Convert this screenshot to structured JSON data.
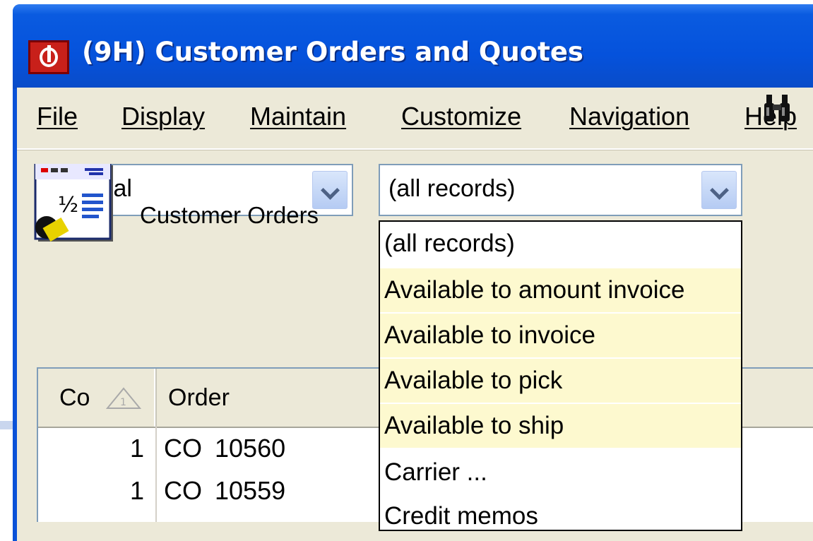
{
  "window": {
    "title": "(9H) Customer Orders and Quotes"
  },
  "menu": [
    {
      "label": "File"
    },
    {
      "label": "Display"
    },
    {
      "label": "Maintain"
    },
    {
      "label": "Customize"
    },
    {
      "label": "Navigation"
    },
    {
      "label": "Help"
    }
  ],
  "toolbar": {
    "view_combo": {
      "value": "General"
    },
    "filter_combo": {
      "value": "(all records)"
    },
    "search_icon": "binoculars-icon"
  },
  "subheader": {
    "icon": "customer-orders-icon",
    "label": "Customer Orders"
  },
  "grid": {
    "columns": [
      {
        "label": "Co",
        "sort_order": "1"
      },
      {
        "label": "Order"
      }
    ],
    "rows": [
      {
        "co": "1",
        "type": "CO",
        "number": "10560"
      },
      {
        "co": "1",
        "type": "CO",
        "number": "10559"
      }
    ]
  },
  "dropdown": {
    "options": [
      {
        "label": "(all records)",
        "highlighted": false
      },
      {
        "label": "Available to amount invoice",
        "highlighted": true
      },
      {
        "label": "Available to invoice",
        "highlighted": true
      },
      {
        "label": "Available to pick",
        "highlighted": true
      },
      {
        "label": "Available to ship",
        "highlighted": true
      },
      {
        "label": "Carrier ...",
        "highlighted": false
      },
      {
        "label": "Credit memos",
        "highlighted": false
      }
    ],
    "highlight_color": "#fdf9cf"
  },
  "colors": {
    "titlebar": "#0552dc",
    "client_bg": "#ece9d8",
    "combo_border": "#7f9db9"
  }
}
